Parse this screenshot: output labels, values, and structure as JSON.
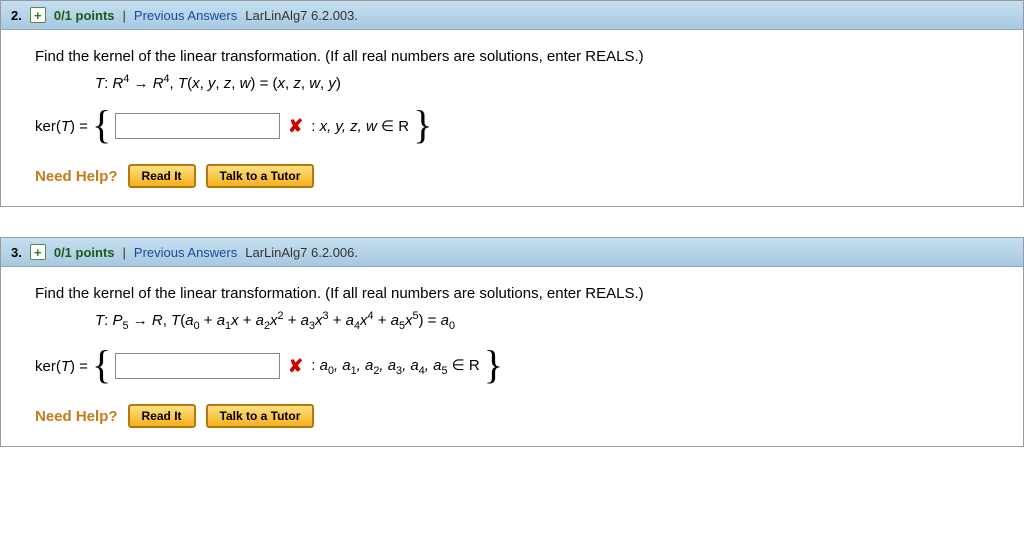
{
  "questions": [
    {
      "number": "2.",
      "points": "0/1 points",
      "prev": "Previous Answers",
      "ref": "LarLinAlg7 6.2.003.",
      "prompt": "Find the kernel of the linear transformation. (If all real numbers are solutions, enter REALS.)",
      "kerLabel": "ker(T) =",
      "condPrefix": ": ",
      "condVars": "x, y, z, w",
      "condSuffix": " ∈ R",
      "needHelp": "Need Help?",
      "readIt": "Read It",
      "tutor": "Talk to a Tutor"
    },
    {
      "number": "3.",
      "points": "0/1 points",
      "prev": "Previous Answers",
      "ref": "LarLinAlg7 6.2.006.",
      "prompt": "Find the kernel of the linear transformation. (If all real numbers are solutions, enter REALS.)",
      "kerLabel": "ker(T) =",
      "condPrefix": ": ",
      "condVars": "a₀, a₁, a₂, a₃, a₄, a₅",
      "condSuffix": " ∈ R",
      "needHelp": "Need Help?",
      "readIt": "Read It",
      "tutor": "Talk to a Tutor"
    }
  ]
}
